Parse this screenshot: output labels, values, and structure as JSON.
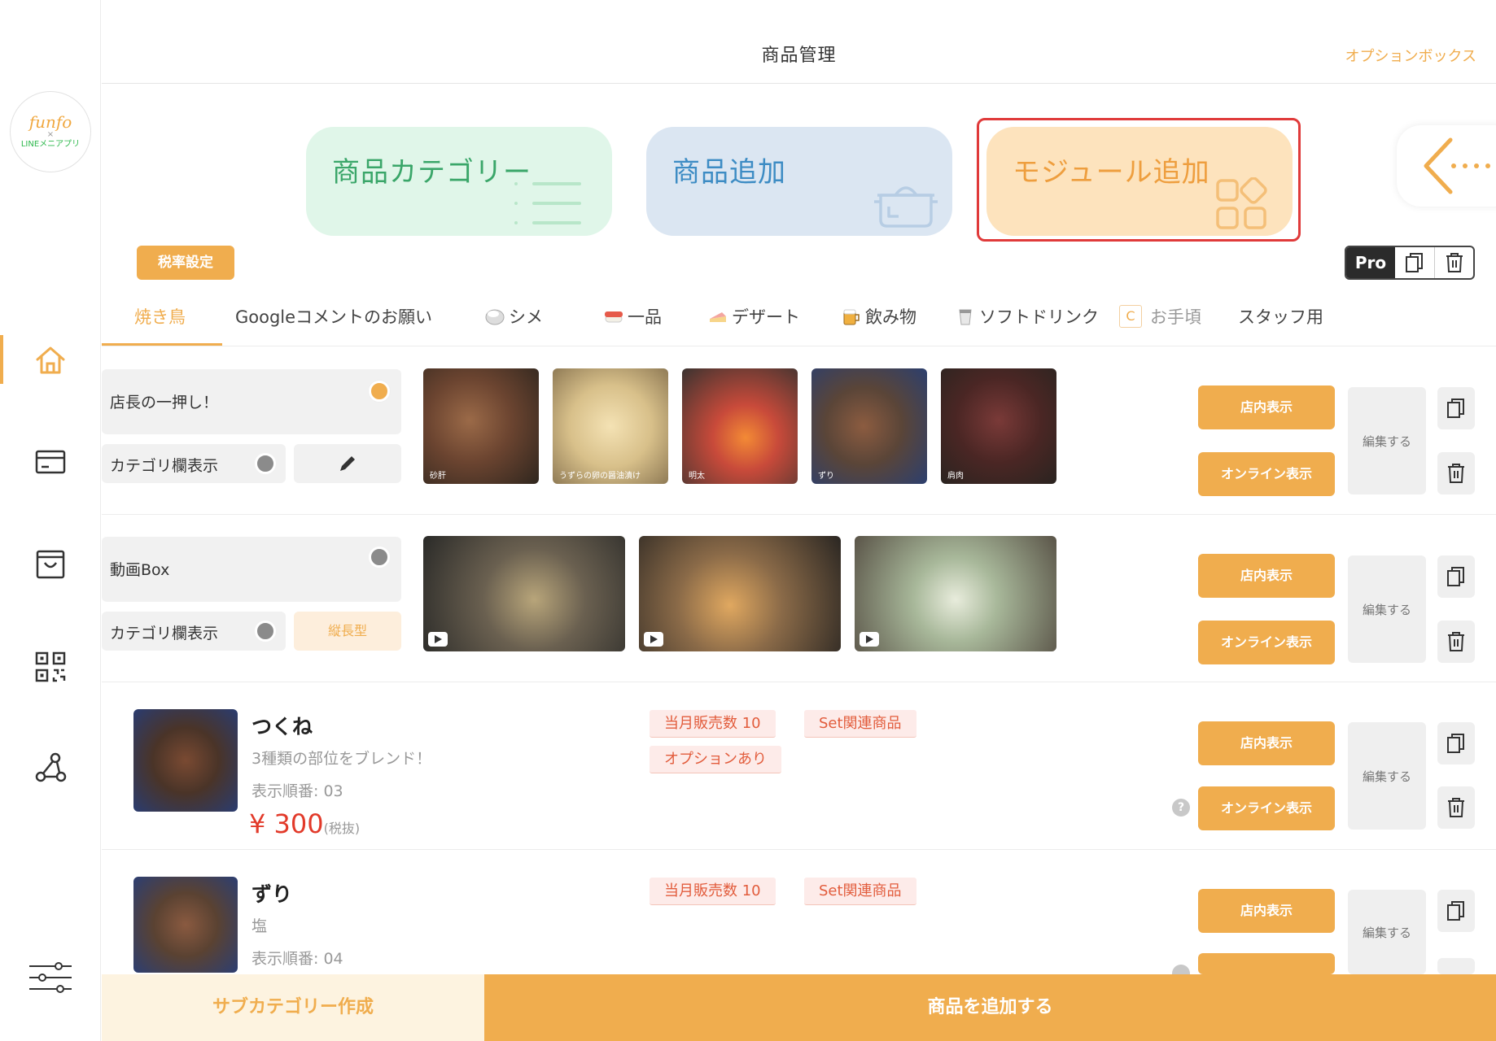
{
  "header": {
    "title": "商品管理",
    "option_box": "オプションボックス"
  },
  "logo": {
    "main": "funfo",
    "x": "×",
    "sub": "LINEメニアプリ"
  },
  "sidebar": {
    "items": [
      {
        "icon": "home-icon",
        "active": true
      },
      {
        "icon": "card-icon",
        "active": false
      },
      {
        "icon": "bag-icon",
        "active": false
      },
      {
        "icon": "qr-code-icon",
        "active": false
      },
      {
        "icon": "network-icon",
        "active": false
      },
      {
        "icon": "sliders-icon",
        "active": false
      }
    ]
  },
  "cards": {
    "category": "商品カテゴリー",
    "add_product": "商品追加",
    "add_module": "モジュール追加"
  },
  "tax_button": "税率設定",
  "pro_toggle": {
    "label": "Pro"
  },
  "tabs": [
    {
      "label": "焼き鳥",
      "active": true
    },
    {
      "label": "Googleコメントのお願い"
    },
    {
      "label": "シメ"
    },
    {
      "label": "一品"
    },
    {
      "label": "デザート"
    },
    {
      "label": "飲み物"
    },
    {
      "label": "ソフトドリンク"
    },
    {
      "label": "お手頃",
      "prefix": "C"
    },
    {
      "label": "スタッフ用"
    }
  ],
  "row1": {
    "title": "店長の一押し！",
    "category_display": "カテゴリ欄表示",
    "thumbs": [
      "砂肝",
      "うずらの卵の醤油漬け",
      "明太",
      "ずり",
      "肩肉"
    ]
  },
  "row2": {
    "title": "動画Box",
    "category_display": "カテゴリ欄表示",
    "layout_tag": "縦長型"
  },
  "buttons": {
    "in_store": "店内表示",
    "online": "オンライン表示",
    "edit": "編集する"
  },
  "products": [
    {
      "name": "つくね",
      "desc": "3種類の部位をブレンド！",
      "order": "表示順番: 03",
      "price": "¥ 300",
      "tax": "(税抜)",
      "tags": [
        "当月販売数 10",
        "Set関連商品",
        "オプションあり"
      ]
    },
    {
      "name": "ずり",
      "desc": "塩",
      "order": "表示順番: 04",
      "tags": [
        "当月販売数 10",
        "Set関連商品"
      ]
    }
  ],
  "bottom": {
    "subcategory": "サブカテゴリー作成",
    "add_product": "商品を追加する"
  },
  "colors": {
    "accent": "#f0ad4e",
    "highlight": "#e03a3a",
    "price": "#e23a2a"
  }
}
